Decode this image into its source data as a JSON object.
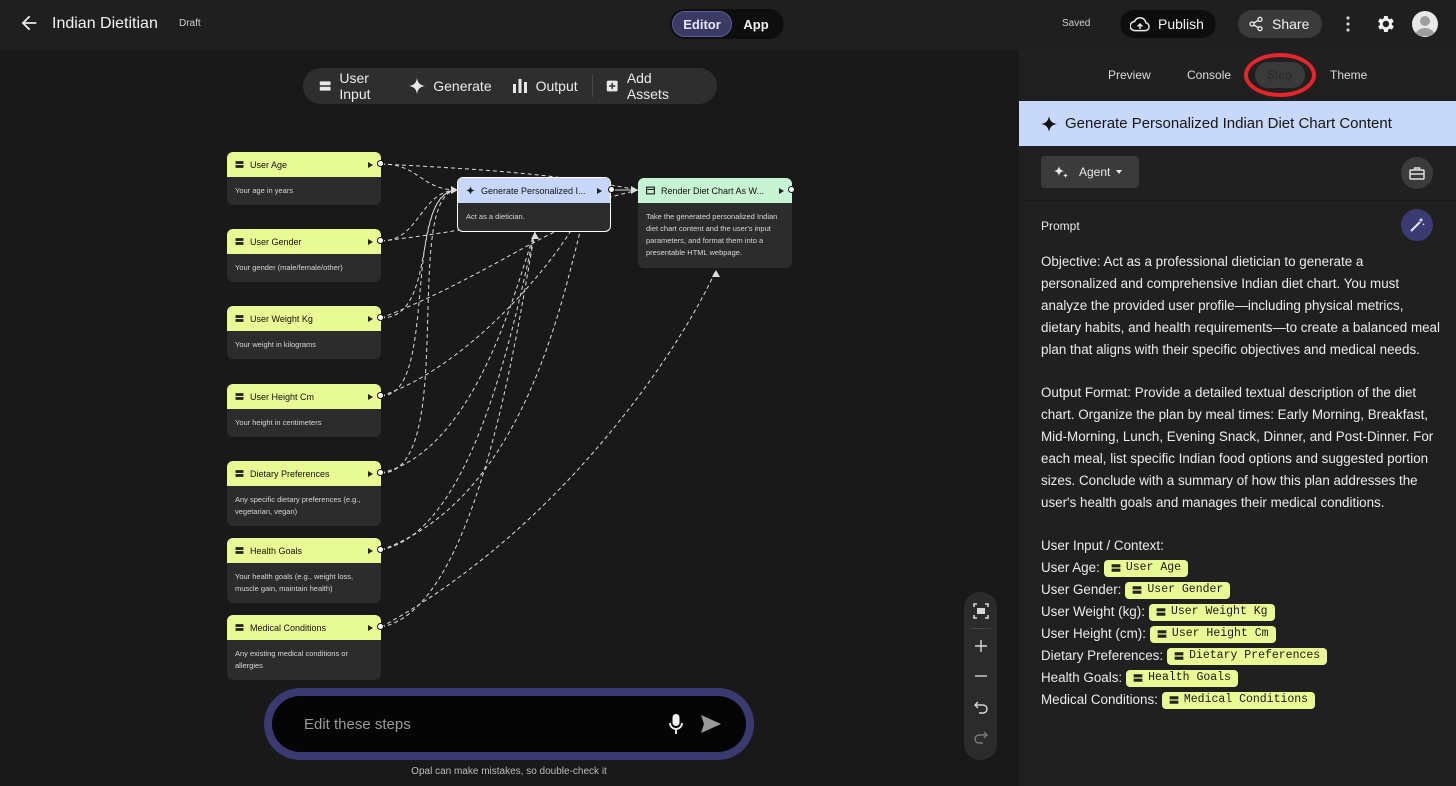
{
  "header": {
    "title": "Indian Dietitian",
    "status": "Draft",
    "modes": [
      "Editor",
      "App"
    ],
    "saved": "Saved",
    "publish": "Publish",
    "share": "Share"
  },
  "toolbar": {
    "items": [
      "User Input",
      "Generate",
      "Output",
      "Add Assets"
    ]
  },
  "nodes": {
    "inputs": [
      {
        "title": "User Age",
        "desc": "Your age in years"
      },
      {
        "title": "User Gender",
        "desc": "Your gender (male/female/other)"
      },
      {
        "title": "User Weight Kg",
        "desc": "Your weight in kilograms"
      },
      {
        "title": "User Height Cm",
        "desc": "Your height in centimeters"
      },
      {
        "title": "Dietary Preferences",
        "desc": "Any specific dietary preferences (e.g., vegetarian, vegan)"
      },
      {
        "title": "Health Goals",
        "desc": "Your health goals (e.g., weight loss, muscle gain, maintain health)"
      },
      {
        "title": "Medical Conditions",
        "desc": "Any existing medical conditions or allergies"
      }
    ],
    "generate": {
      "title": "Generate Personalized I...",
      "desc": "Act as a dietician."
    },
    "output": {
      "title": "Render Diet Chart As W...",
      "desc": "Take the generated personalized Indian diet chart content and the user's input parameters, and format them into a presentable HTML webpage."
    }
  },
  "chat": {
    "placeholder": "Edit these steps",
    "disclaimer": "Opal can make mistakes, so double-check it"
  },
  "panel": {
    "tabs": [
      "Preview",
      "Console",
      "Step",
      "Theme"
    ],
    "active_tab": "Step",
    "step_title": "Generate Personalized Indian Diet Chart Content",
    "agent_label": "Agent",
    "prompt_label": "Prompt",
    "objective": "Objective: Act as a professional dietician to generate a personalized and comprehensive Indian diet chart. You must analyze the provided user profile—including physical metrics, dietary habits, and health requirements—to create a balanced meal plan that aligns with their specific objectives and medical needs.",
    "output_format": "Output Format: Provide a detailed textual description of the diet chart. Organize the plan by meal times: Early Morning, Breakfast, Mid-Morning, Lunch, Evening Snack, Dinner, and Post-Dinner. For each meal, list specific Indian food options and suggested portion sizes. Conclude with a summary of how this plan addresses the user's health goals and manages their medical conditions.",
    "context_header": "User Input / Context:",
    "context": [
      {
        "label": "User Age:",
        "chip": "User Age"
      },
      {
        "label": "User Gender:",
        "chip": "User Gender"
      },
      {
        "label": "User Weight (kg):",
        "chip": "User Weight Kg"
      },
      {
        "label": "User Height (cm):",
        "chip": "User Height Cm"
      },
      {
        "label": "Dietary Preferences:",
        "chip": "Dietary Preferences"
      },
      {
        "label": "Health Goals:",
        "chip": "Health Goals"
      },
      {
        "label": "Medical Conditions:",
        "chip": "Medical Conditions"
      }
    ]
  },
  "colors": {
    "input_node": "#e8fa94",
    "generate_node": "#c6d7fb",
    "output_node": "#c6f3d2",
    "editor_accent": "#3b3a63",
    "highlight_ring": "#e8262a"
  }
}
